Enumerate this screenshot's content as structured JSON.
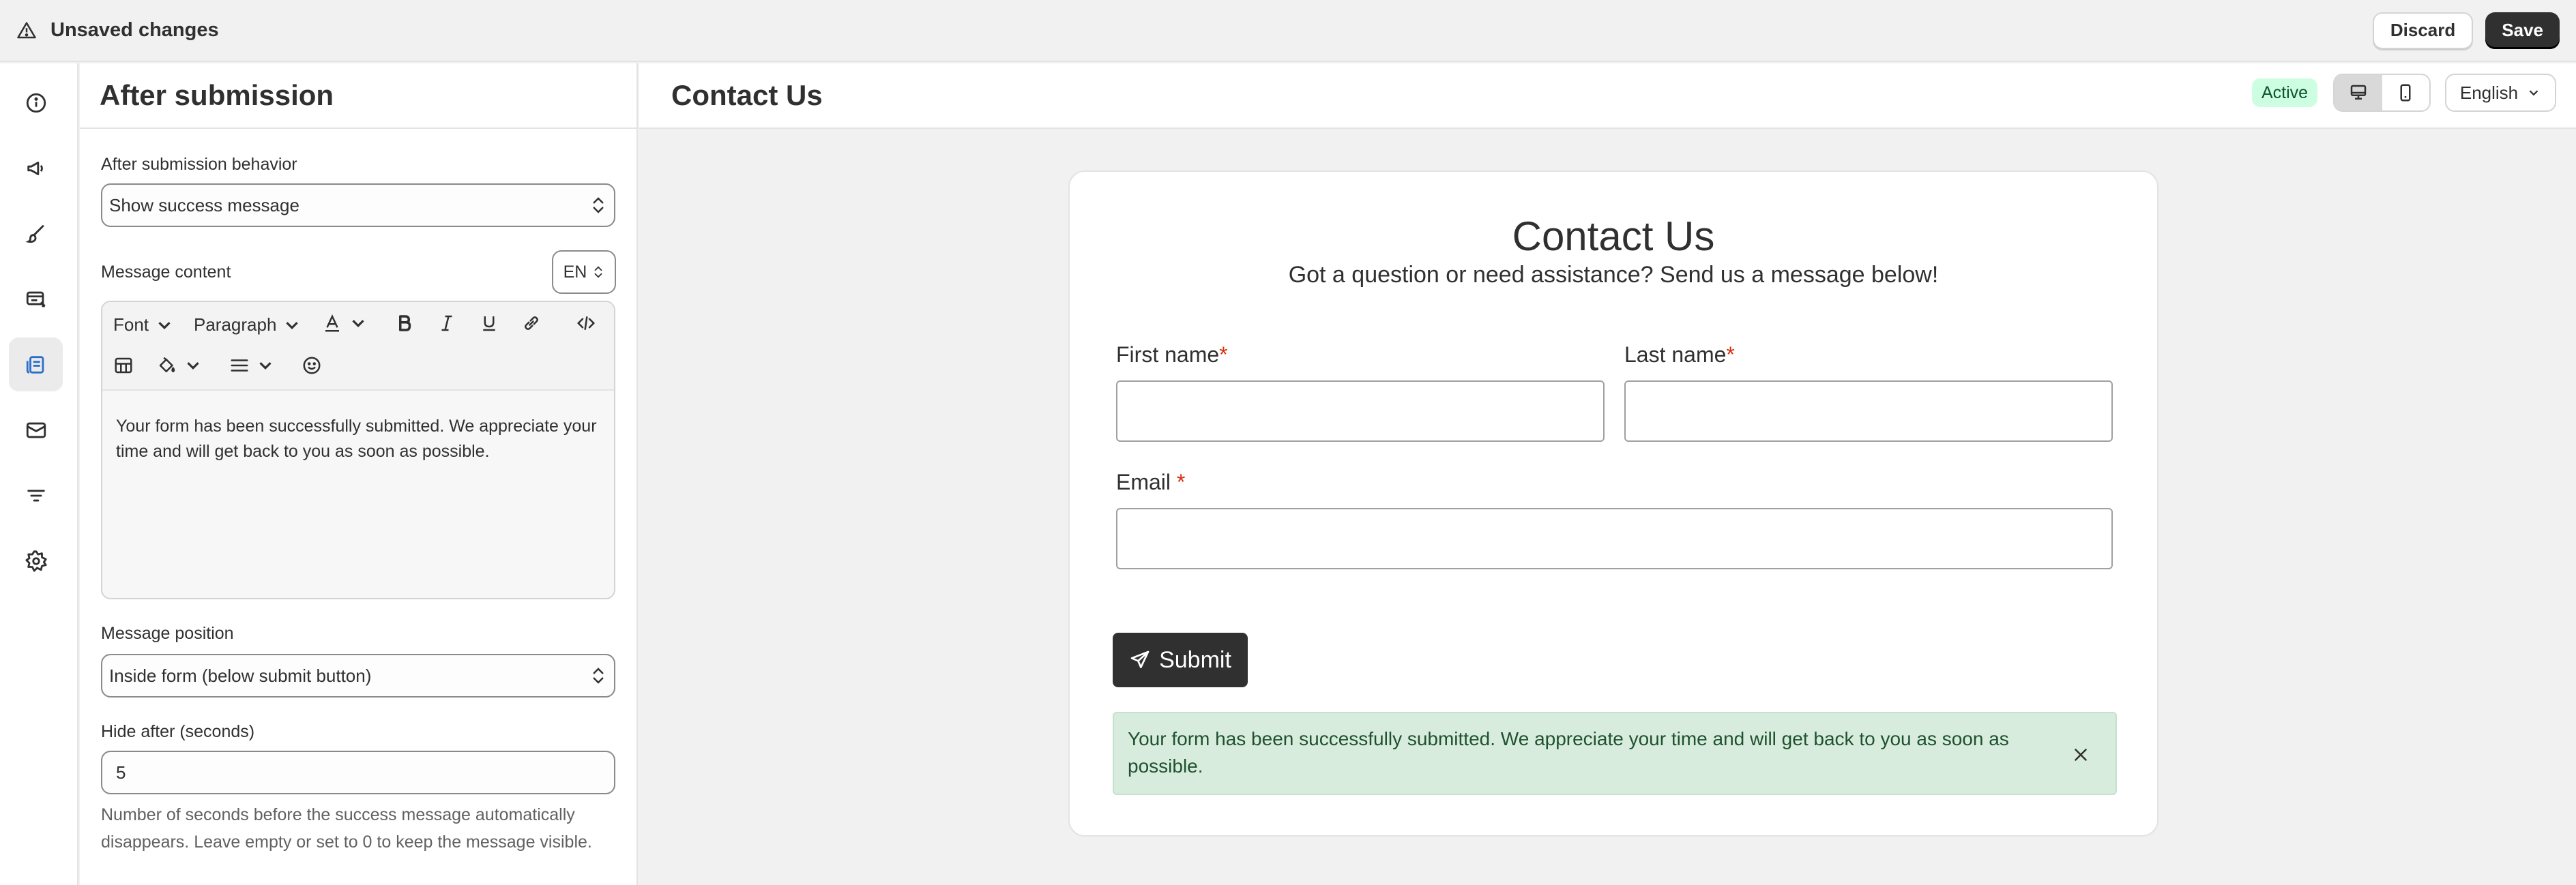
{
  "topbar": {
    "title": "Unsaved changes",
    "discard_label": "Discard",
    "save_label": "Save"
  },
  "rail": {
    "items": [
      {
        "icon": "info-icon"
      },
      {
        "icon": "megaphone-icon"
      },
      {
        "icon": "brush-icon"
      },
      {
        "icon": "form-list-icon"
      },
      {
        "icon": "after-submission-icon",
        "active": true
      },
      {
        "icon": "mail-icon"
      },
      {
        "icon": "filter-icon"
      },
      {
        "icon": "gear-icon"
      }
    ]
  },
  "panel": {
    "title": "After submission",
    "behavior": {
      "label": "After submission behavior",
      "value": "Show success message"
    },
    "message": {
      "label": "Message content",
      "lang": "EN",
      "toolbar": {
        "font": "Font",
        "paragraph": "Paragraph"
      },
      "content": "Your form has been successfully submitted. We appreciate your time and will get back to you as soon as possible."
    },
    "position": {
      "label": "Message position",
      "value": "Inside form (below submit button)"
    },
    "hide_after": {
      "label": "Hide after (seconds)",
      "value": "5",
      "help": "Number of seconds before the success message automatically disappears. Leave empty or set to 0 to keep the message visible."
    }
  },
  "preview": {
    "title": "Contact Us",
    "status": "Active",
    "language": "English",
    "form": {
      "title": "Contact Us",
      "subtitle": "Got a question or need assistance? Send us a message below!",
      "first_name": "First name",
      "last_name": "Last name",
      "email": "Email ",
      "required_mark": "*",
      "submit_label": "Submit",
      "success_message": "Your form has been successfully submitted. We appreciate your time and will get back to you as soon as possible."
    }
  },
  "colors": {
    "primary": "#303030",
    "success_bg": "#d8ecdd",
    "badge_bg": "#cdfee1",
    "required": "#d72c0d"
  }
}
